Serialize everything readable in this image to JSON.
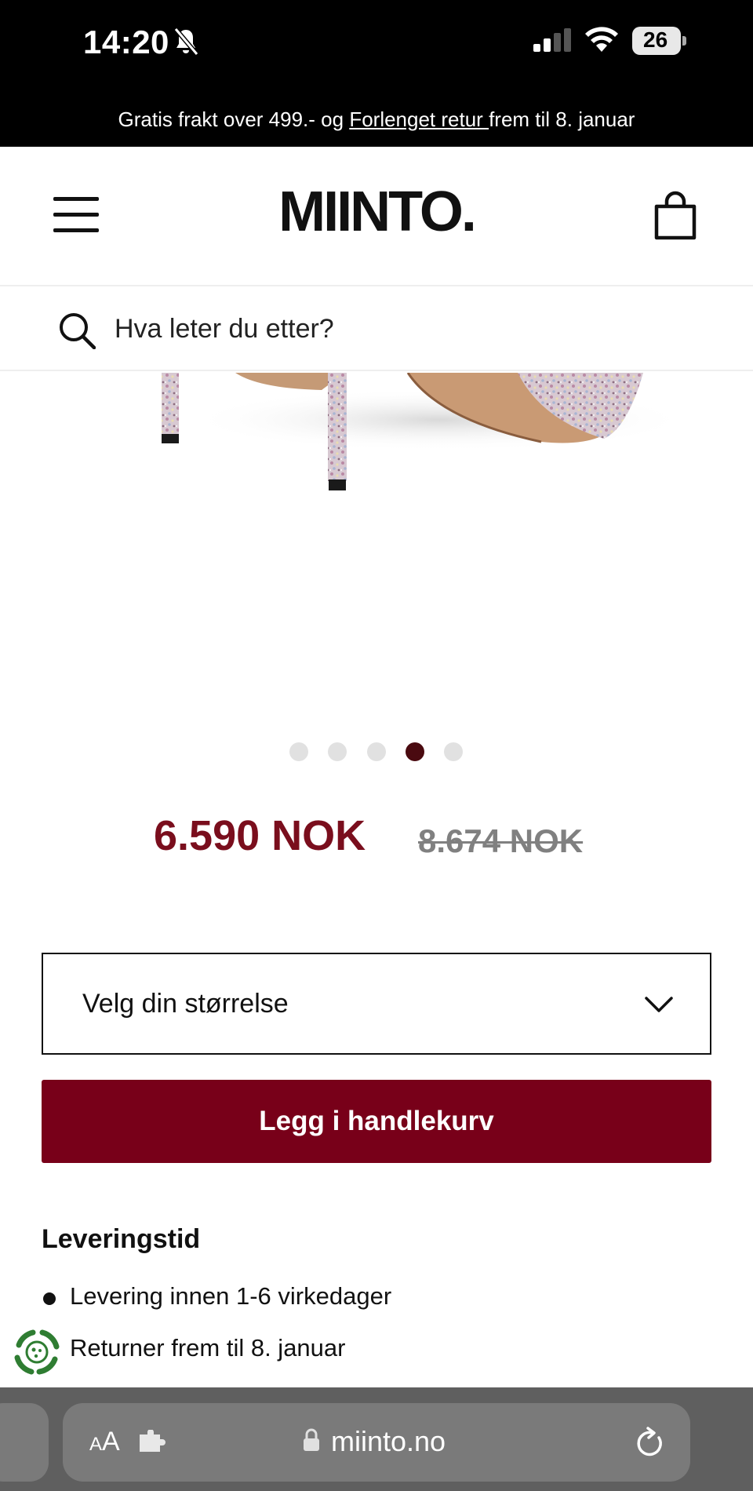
{
  "status_bar": {
    "time": "14:20",
    "battery": "26"
  },
  "promo": {
    "before": "Gratis frakt over 499.- og ",
    "link": "Forlenget retur ",
    "after": "frem til 8. januar"
  },
  "header": {
    "logo": "MIINTO."
  },
  "search": {
    "placeholder": "Hva leter du etter?"
  },
  "carousel": {
    "dot_count": 5,
    "active_index": 3
  },
  "price": {
    "current": "6.590 NOK",
    "original": "8.674 NOK"
  },
  "size_select": {
    "label": "Velg din størrelse"
  },
  "cart": {
    "add_label": "Legg i handlekurv"
  },
  "delivery": {
    "heading": "Leveringstid",
    "items": [
      "Levering innen 1-6 virkedager",
      "Returner frem til 8. januar"
    ]
  },
  "browser": {
    "aa_small": "A",
    "aa_large": "A",
    "url": "miinto.no"
  },
  "colors": {
    "accent": "#780019",
    "price": "#7a0e1d",
    "active_dot": "#4a0a10"
  }
}
